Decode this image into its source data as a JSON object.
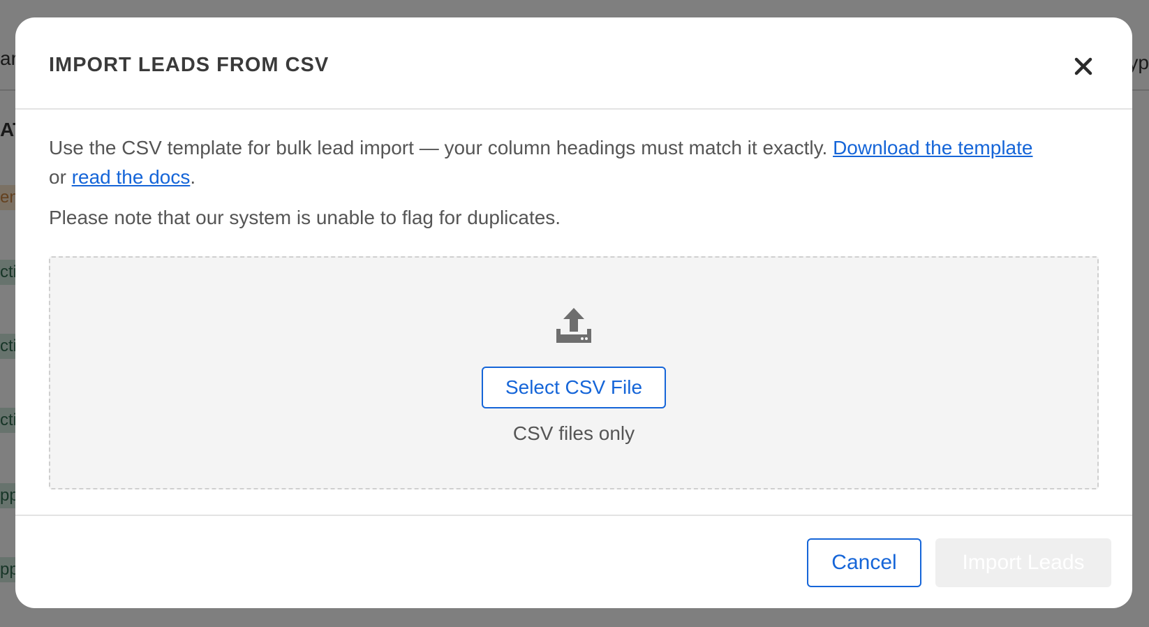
{
  "background": {
    "fragments": [
      {
        "text": "ar",
        "pos": "a"
      },
      {
        "text": "AT",
        "pos": "b"
      },
      {
        "text": "yp",
        "pos": "c"
      }
    ],
    "pills": [
      {
        "text": "end",
        "color": "#c9833f",
        "bg": "#f6e2c8"
      },
      {
        "text": "ctiv",
        "color": "#2e6b4f",
        "bg": "#cfe6da"
      },
      {
        "text": "ctiv",
        "color": "#2e6b4f",
        "bg": "#cfe6da"
      },
      {
        "text": "ctiv",
        "color": "#2e6b4f",
        "bg": "#cfe6da"
      },
      {
        "text": "ppr",
        "color": "#2e6b4f",
        "bg": "#cfe6da"
      },
      {
        "text": "ppr",
        "color": "#2e6b4f",
        "bg": "#cfe6da"
      }
    ]
  },
  "modal": {
    "title": "IMPORT LEADS FROM CSV",
    "close_icon": "close-icon",
    "intro_text": "Use the CSV template for bulk lead import — your column headings must match it exactly. ",
    "download_link": "Download the template",
    "or_text": " or ",
    "docs_link": "read the docs",
    "period": ".",
    "note": "Please note that our system is unable to flag for duplicates.",
    "dropzone": {
      "icon": "upload-icon",
      "button_label": "Select CSV File",
      "hint": "CSV files only"
    },
    "footer": {
      "cancel_label": "Cancel",
      "import_label": "Import Leads",
      "import_disabled": true
    }
  },
  "colors": {
    "accent": "#1565d8",
    "text": "#555555",
    "title": "#3a3a3a",
    "disabled_bg": "#efefef"
  }
}
